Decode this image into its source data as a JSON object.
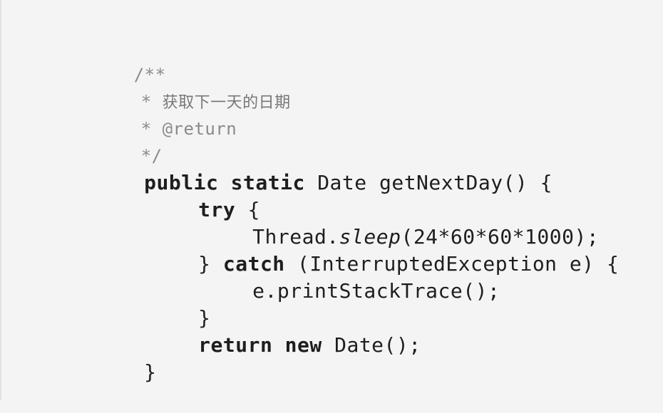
{
  "code": {
    "comment_open": "/**",
    "comment_line1_star": "*",
    "comment_line1_text": "获取下一天的日期",
    "comment_line2_star": "*",
    "comment_line2_text": "@return",
    "comment_close": "*/",
    "sig_public": "public",
    "sig_static": "static",
    "sig_rest": "Date getNextDay() {",
    "try_kw": "try",
    "try_brace": "{",
    "sleep_prefix": "Thread.",
    "sleep_method": "sleep",
    "sleep_args": "(24*60*60*1000);",
    "catch_open": "}",
    "catch_kw": "catch",
    "catch_rest": "(InterruptedException e) {",
    "print_stmt": "e.printStackTrace();",
    "catch_close": "}",
    "return_kw": "return",
    "new_kw": "new",
    "return_rest": "Date();",
    "method_close": "}"
  }
}
